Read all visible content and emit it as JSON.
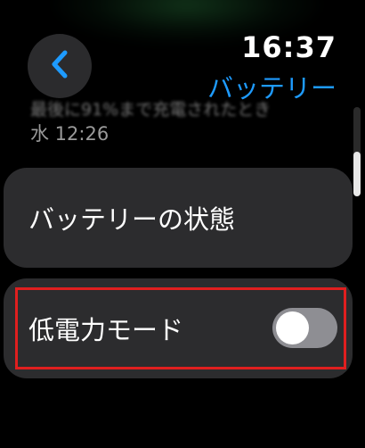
{
  "status": {
    "time": "16:37"
  },
  "header": {
    "title": "バッテリー",
    "back_icon": "chevron-left-icon"
  },
  "info": {
    "last_charged_text": "最後に91%まで充電されたとき",
    "last_charged_time": "水 12:26"
  },
  "rows": {
    "battery_health": {
      "label": "バッテリーの状態"
    },
    "low_power_mode": {
      "label": "低電力モード",
      "enabled": false
    }
  },
  "colors": {
    "accent": "#1e9bff",
    "highlight": "#e01f1f",
    "row_bg": "#2c2c2e",
    "toggle_off": "#8e8e93"
  }
}
